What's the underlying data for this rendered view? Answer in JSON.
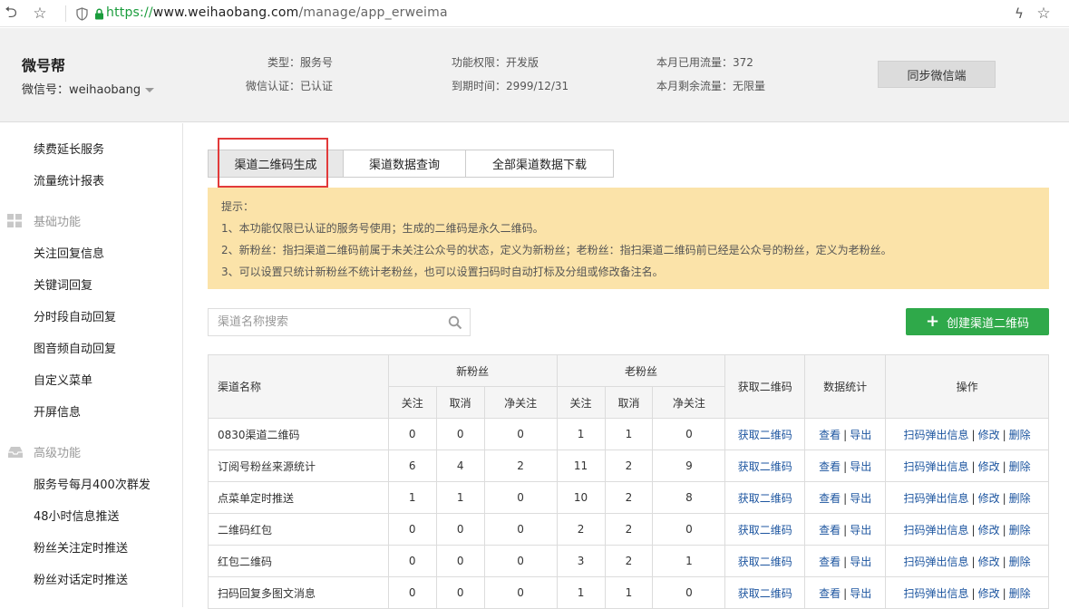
{
  "browser": {
    "url_protocol": "https://",
    "url_host": "www.weihaobang.com",
    "url_path": "/manage/app_erweima"
  },
  "account": {
    "name": "微号帮",
    "wechat_id": "微信号：weihaobang",
    "type": "类型：服务号",
    "verify": "微信认证：已认证",
    "permission": "功能权限：开发版",
    "expire": "到期时间：2999/12/31",
    "traffic_used": "本月已用流量：372",
    "traffic_left": "本月剩余流量：无限量",
    "sync_button": "同步微信端"
  },
  "sidebar": {
    "top_items": [
      "续费延长服务",
      "流量统计报表"
    ],
    "group_basic": "基础功能",
    "basic_items": [
      "关注回复信息",
      "关键词回复",
      "分时段自动回复",
      "图音频自动回复",
      "自定义菜单",
      "开屏信息"
    ],
    "group_advanced": "高级功能",
    "advanced_items": [
      "服务号每月400次群发",
      "48小时信息推送",
      "粉丝关注定时推送",
      "粉丝对话定时推送"
    ]
  },
  "tabs": [
    "渠道二维码生成",
    "渠道数据查询",
    "全部渠道数据下载"
  ],
  "tip": {
    "title": "提示：",
    "lines": [
      "1、本功能仅限已认证的服务号使用；生成的二维码是永久二维码。",
      "2、新粉丝：指扫渠道二维码前属于未关注公众号的状态，定义为新粉丝；老粉丝：指扫渠道二维码前已经是公众号的粉丝，定义为老粉丝。",
      "3、可以设置只统计新粉丝不统计老粉丝，也可以设置扫码时自动打标及分组或修改备注名。"
    ]
  },
  "search": {
    "placeholder": "渠道名称搜索"
  },
  "create_button": "创建渠道二维码",
  "table": {
    "headers": {
      "name": "渠道名称",
      "new_fans": "新粉丝",
      "old_fans": "老粉丝",
      "get_qr": "获取二维码",
      "stats": "数据统计",
      "ops": "操作",
      "follow": "关注",
      "cancel": "取消",
      "net": "净关注"
    },
    "link_labels": {
      "get_qr": "获取二维码",
      "view": "查看",
      "export": "导出",
      "popup": "扫码弹出信息",
      "edit": "修改",
      "delete": "删除",
      "sep": "|"
    },
    "rows": [
      {
        "name": "0830渠道二维码",
        "nf": "0",
        "nc": "0",
        "nn": "0",
        "of": "1",
        "oc": "1",
        "on": "0"
      },
      {
        "name": "订阅号粉丝来源统计",
        "nf": "6",
        "nc": "4",
        "nn": "2",
        "of": "11",
        "oc": "2",
        "on": "9"
      },
      {
        "name": "点菜单定时推送",
        "nf": "1",
        "nc": "1",
        "nn": "0",
        "of": "10",
        "oc": "2",
        "on": "8"
      },
      {
        "name": "二维码红包",
        "nf": "0",
        "nc": "0",
        "nn": "0",
        "of": "2",
        "oc": "2",
        "on": "0"
      },
      {
        "name": "红包二维码",
        "nf": "0",
        "nc": "0",
        "nn": "0",
        "of": "3",
        "oc": "2",
        "on": "1"
      },
      {
        "name": "扫码回复多图文消息",
        "nf": "0",
        "nc": "0",
        "nn": "0",
        "of": "1",
        "oc": "1",
        "on": "0"
      }
    ]
  }
}
